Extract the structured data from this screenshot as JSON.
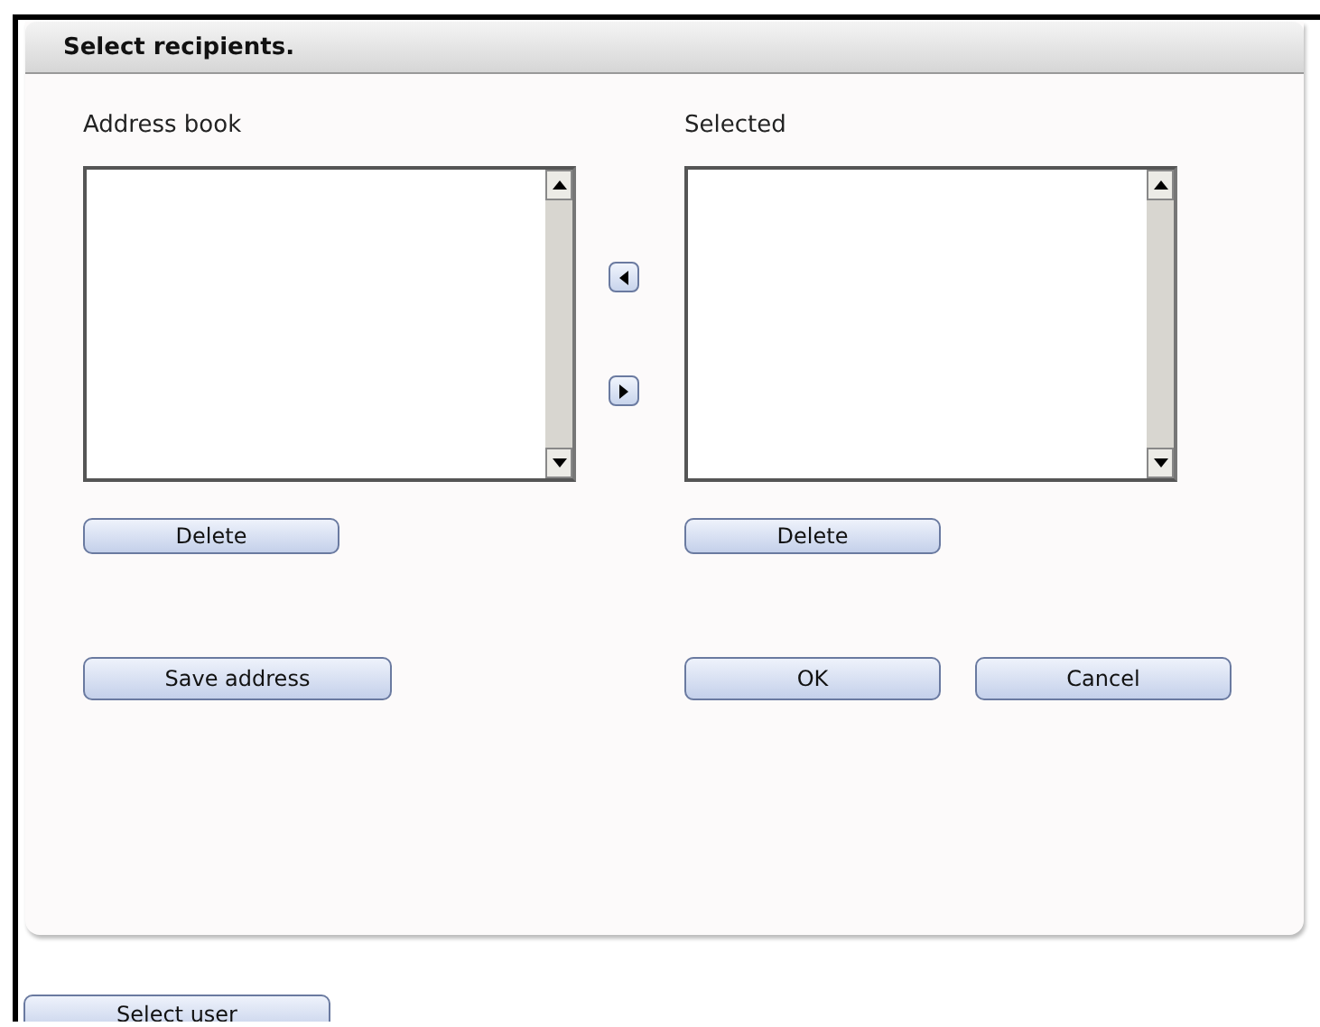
{
  "dialog": {
    "title": "Select recipients."
  },
  "lists": [
    {
      "label": "Address book",
      "delete_button": "Delete"
    },
    {
      "label": "Selected",
      "delete_button": "Delete"
    }
  ],
  "save_button": "Save address",
  "buttons": [
    "OK",
    "Cancel"
  ],
  "select_user_button": "Select user"
}
